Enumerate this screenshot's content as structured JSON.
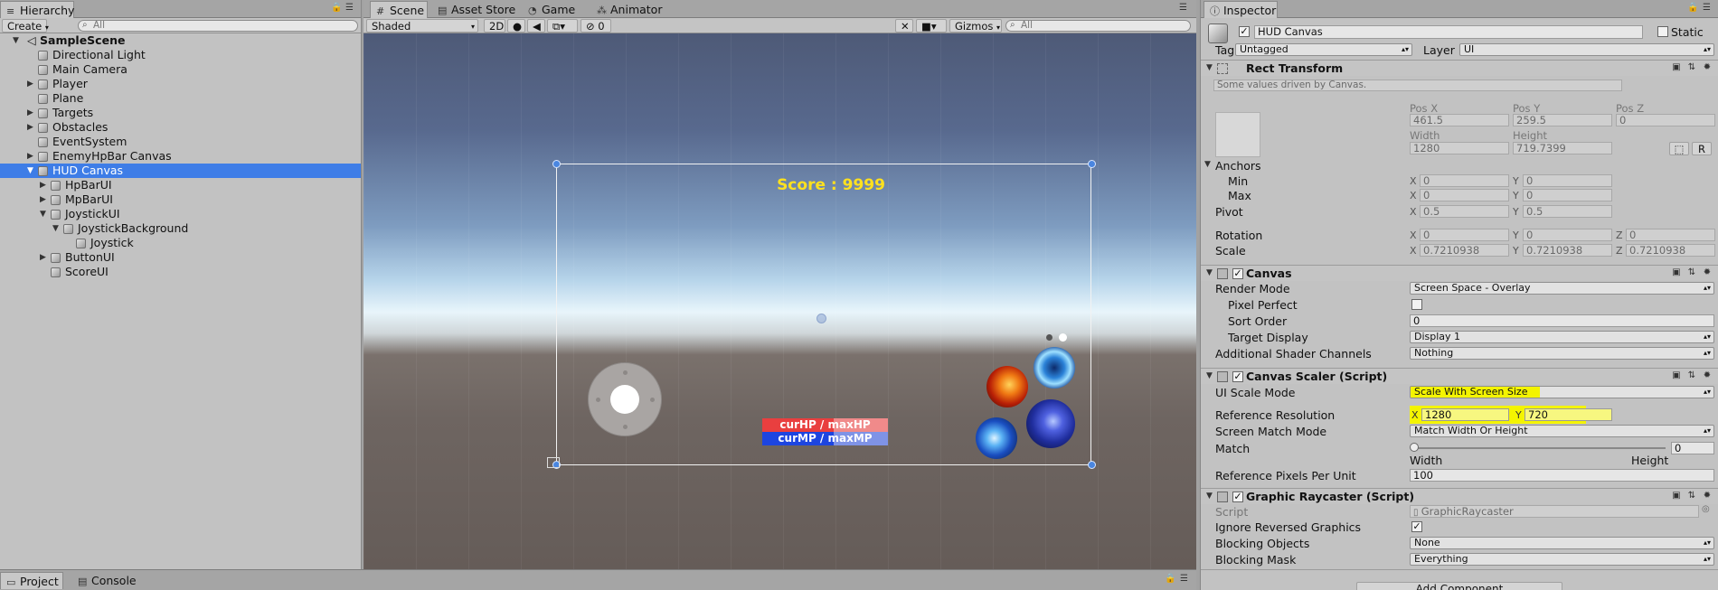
{
  "hierarchy": {
    "tab": "Hierarchy",
    "create_label": "Create",
    "search_placeholder": "All",
    "scene_name": "SampleScene",
    "items": [
      {
        "label": "Directional Light"
      },
      {
        "label": "Main Camera"
      },
      {
        "label": "Player"
      },
      {
        "label": "Plane"
      },
      {
        "label": "Targets"
      },
      {
        "label": "Obstacles"
      },
      {
        "label": "EventSystem"
      },
      {
        "label": "EnemyHpBar Canvas"
      },
      {
        "label": "HUD Canvas"
      },
      {
        "label": "HpBarUI"
      },
      {
        "label": "MpBarUI"
      },
      {
        "label": "JoystickUI"
      },
      {
        "label": "JoystickBackground"
      },
      {
        "label": "Joystick"
      },
      {
        "label": "ButtonUI"
      },
      {
        "label": "ScoreUI"
      }
    ],
    "selected": "HUD Canvas"
  },
  "scene_view": {
    "tabs": [
      {
        "label": "Scene",
        "icon": "hash-icon"
      },
      {
        "label": "Asset Store",
        "icon": "store-icon"
      },
      {
        "label": "Game",
        "icon": "pacman-icon"
      },
      {
        "label": "Animator",
        "icon": "animator-icon"
      }
    ],
    "active_tab": "Scene",
    "shading_mode": "Shaded",
    "mode_2d": "2D",
    "hidden_count": "0",
    "gizmos_label": "Gizmos",
    "search_placeholder": "All",
    "hud": {
      "score_text": "Score : 9999",
      "hp_text": "curHP / maxHP",
      "mp_text": "curMP / maxMP"
    },
    "colors": {
      "score": "#ffe11e",
      "hp": "#e93f3f",
      "mp": "#1d45e0",
      "selection": "#3e7de7"
    }
  },
  "inspector": {
    "tab": "Inspector",
    "object_name": "HUD Canvas",
    "static_label": "Static",
    "tag_label": "Tag",
    "tag_value": "Untagged",
    "layer_label": "Layer",
    "layer_value": "UI",
    "rect_transform": {
      "title": "Rect Transform",
      "note": "Some values driven by Canvas.",
      "pos_x_label": "Pos X",
      "pos_x": "461.5",
      "pos_y_label": "Pos Y",
      "pos_y": "259.5",
      "pos_z_label": "Pos Z",
      "pos_z": "0",
      "width_label": "Width",
      "width": "1280",
      "height_label": "Height",
      "height": "719.7399",
      "r_button": "R",
      "anchors_label": "Anchors",
      "min_label": "Min",
      "min_x": "0",
      "min_y": "0",
      "max_label": "Max",
      "max_x": "0",
      "max_y": "0",
      "pivot_label": "Pivot",
      "pivot_x": "0.5",
      "pivot_y": "0.5",
      "rotation_label": "Rotation",
      "rot_x": "0",
      "rot_y": "0",
      "rot_z": "0",
      "scale_label": "Scale",
      "scale_x": "0.7210938",
      "scale_y": "0.7210938",
      "scale_z": "0.7210938"
    },
    "canvas": {
      "title": "Canvas",
      "render_mode_label": "Render Mode",
      "render_mode": "Screen Space - Overlay",
      "pixel_perfect_label": "Pixel Perfect",
      "sort_order_label": "Sort Order",
      "sort_order": "0",
      "target_display_label": "Target Display",
      "target_display": "Display 1",
      "shader_channels_label": "Additional Shader Channels",
      "shader_channels": "Nothing"
    },
    "canvas_scaler": {
      "title": "Canvas Scaler (Script)",
      "scale_mode_label": "UI Scale Mode",
      "scale_mode": "Scale With Screen Size",
      "ref_res_label": "Reference Resolution",
      "ref_x": "1280",
      "ref_y": "720",
      "match_mode_label": "Screen Match Mode",
      "match_mode": "Match Width Or Height",
      "match_label": "Match",
      "match_value": "0",
      "width_label": "Width",
      "height_label": "Height",
      "ref_ppu_label": "Reference Pixels Per Unit",
      "ref_ppu": "100"
    },
    "graphic_raycaster": {
      "title": "Graphic Raycaster (Script)",
      "script_label": "Script",
      "script_value": "GraphicRaycaster",
      "ignore_reversed_label": "Ignore Reversed Graphics",
      "blocking_objects_label": "Blocking Objects",
      "blocking_objects": "None",
      "blocking_mask_label": "Blocking Mask",
      "blocking_mask": "Everything"
    },
    "add_component": "Add Component"
  },
  "bottom": {
    "tabs": [
      {
        "label": "Project",
        "icon": "folder-icon"
      },
      {
        "label": "Console",
        "icon": "console-icon"
      }
    ]
  }
}
